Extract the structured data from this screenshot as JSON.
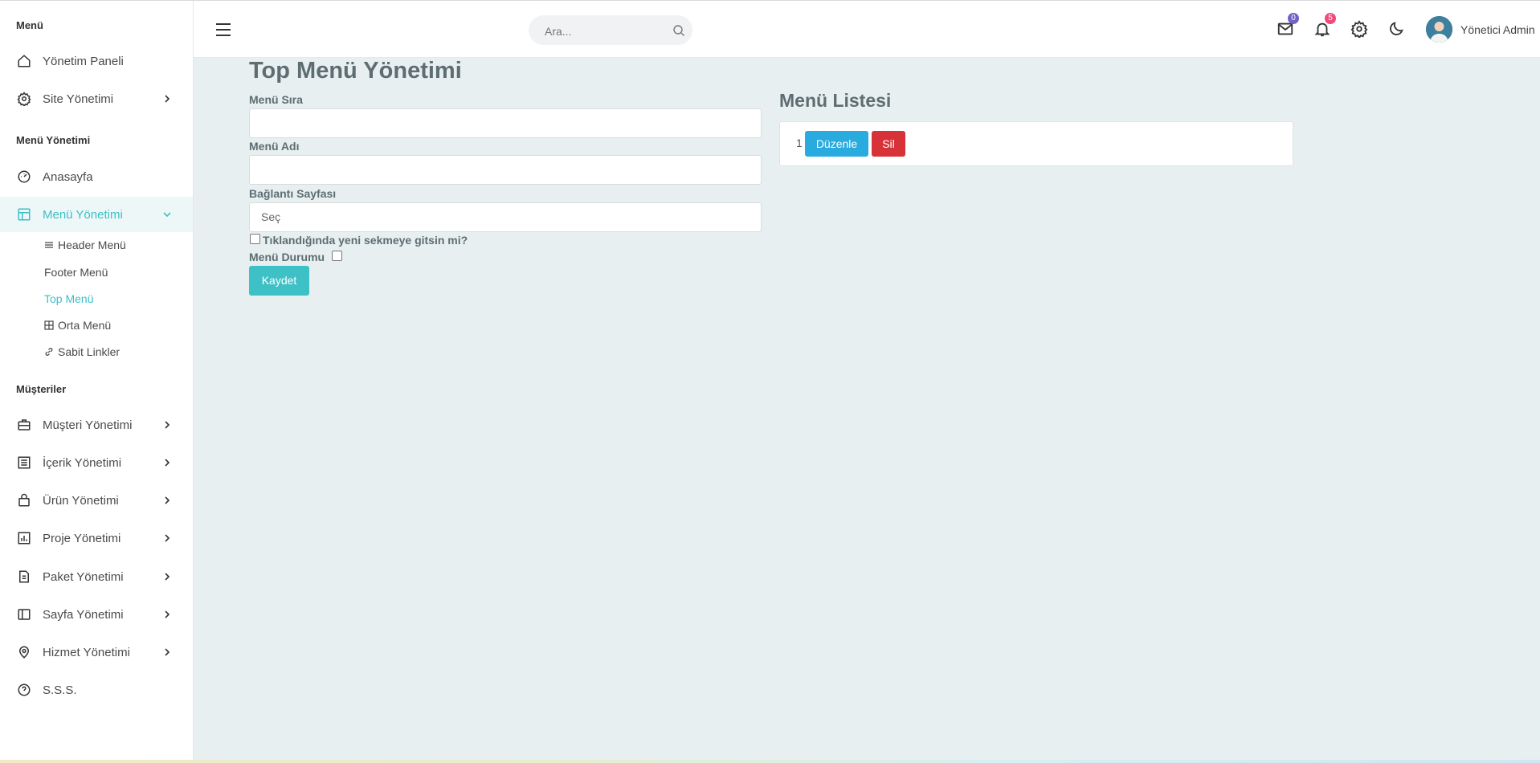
{
  "sidebar": {
    "sections": [
      "Menü",
      "Menü Yönetimi",
      "Müşteriler"
    ],
    "items": [
      {
        "label": "Yönetim Paneli",
        "icon": "home-icon"
      },
      {
        "label": "Site Yönetimi",
        "icon": "gear-icon"
      },
      {
        "label": "Anasayfa",
        "icon": "dashboard-icon"
      },
      {
        "label": "Menü Yönetimi",
        "icon": "layout-icon"
      },
      {
        "label": "Müşteri Yönetimi",
        "icon": "briefcase-icon"
      },
      {
        "label": "İçerik Yönetimi",
        "icon": "list-icon"
      },
      {
        "label": "Ürün Yönetimi",
        "icon": "bag-icon"
      },
      {
        "label": "Proje Yönetimi",
        "icon": "bar-chart-icon"
      },
      {
        "label": "Paket Yönetimi",
        "icon": "document-icon"
      },
      {
        "label": "Sayfa Yönetimi",
        "icon": "sidebar-icon"
      },
      {
        "label": "Hizmet Yönetimi",
        "icon": "map-pin-icon"
      },
      {
        "label": "S.S.S.",
        "icon": "help-circle-icon"
      }
    ],
    "subitems": [
      {
        "label": "Header Menü",
        "icon": "list-icon"
      },
      {
        "label": "Footer Menü",
        "icon": ""
      },
      {
        "label": "Top Menü",
        "icon": ""
      },
      {
        "label": "Orta Menü",
        "icon": "grid-icon"
      },
      {
        "label": "Sabit Linkler",
        "icon": "link-icon"
      }
    ]
  },
  "header": {
    "search_placeholder": "Ara...",
    "mail_count": "0",
    "notification_count": "5",
    "user_name": "Yönetici Admin"
  },
  "main": {
    "title": "Top Menü Yönetimi",
    "fields": {
      "order_label": "Menü Sıra",
      "name_label": "Menü Adı",
      "link_label": "Bağlantı Sayfası",
      "link_value": "Seç",
      "new_tab_label": "Tıklandığında yeni sekmeye gitsin mi?",
      "status_label": "Menü Durumu"
    },
    "save_label": "Kaydet",
    "list": {
      "title": "Menü Listesi",
      "rows": [
        {
          "number": "1",
          "edit_label": "Düzenle",
          "delete_label": "Sil"
        }
      ]
    }
  },
  "colors": {
    "accent": "#3ec1c6",
    "edit_button": "#29abdf",
    "delete_button": "#d73237",
    "mail_badge": "#6f62c6",
    "notification_badge": "#ef4a78",
    "content_bg": "#e8eff0"
  }
}
